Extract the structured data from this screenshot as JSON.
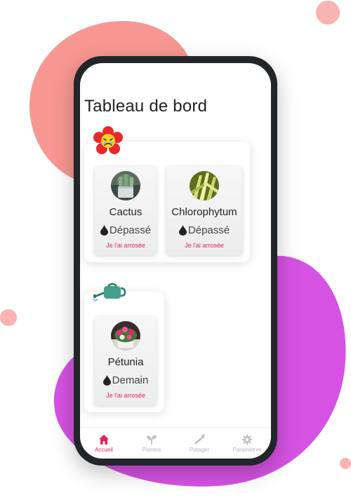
{
  "page": {
    "title": "Tableau de bord"
  },
  "colors": {
    "accent": "#e0245e",
    "blob_salmon": "#f7857e",
    "blob_purple": "#d03fe0",
    "phone_frame": "#222629"
  },
  "groups": [
    {
      "badge_icon": "sad-flower-icon",
      "plants": [
        {
          "name": "Cactus",
          "status": "Dépassé",
          "action": "Je l'ai arrosée",
          "photo_icon": "cactus-photo"
        },
        {
          "name": "Chlorophytum",
          "status": "Dépassé",
          "action": "Je l'ai arrosée",
          "photo_icon": "chlorophytum-photo"
        }
      ]
    },
    {
      "badge_icon": "watering-can-icon",
      "plants": [
        {
          "name": "Pétunia",
          "status": "Demain",
          "action": "Je l'ai arrosée",
          "photo_icon": "petunia-photo"
        }
      ]
    }
  ],
  "tabbar": {
    "tabs": [
      {
        "label": "Accueil",
        "icon": "home-icon",
        "active": true
      },
      {
        "label": "Plantes",
        "icon": "sprout-icon",
        "active": false
      },
      {
        "label": "Potager",
        "icon": "carrot-icon",
        "active": false
      },
      {
        "label": "Paramètres",
        "icon": "gear-icon",
        "active": false
      }
    ]
  }
}
